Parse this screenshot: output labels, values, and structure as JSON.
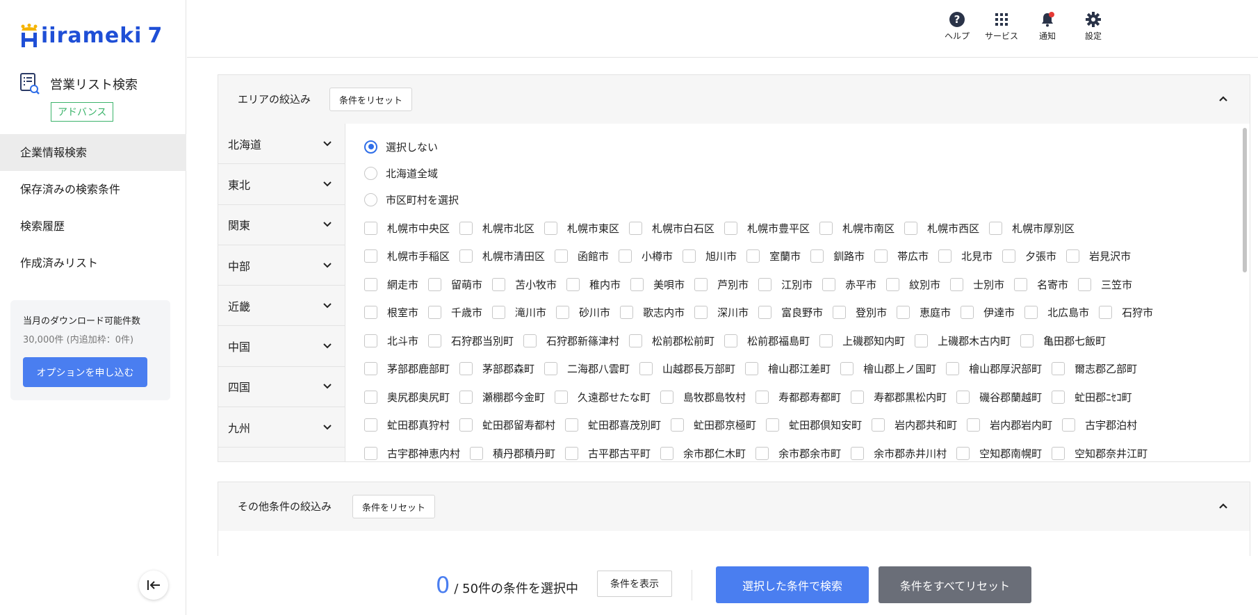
{
  "app": {
    "logo_main": "iirameki",
    "logo_num": "7"
  },
  "product": {
    "title": "営業リスト検索",
    "badge": "アドバンス"
  },
  "nav": [
    {
      "label": "企業情報検索",
      "active": true
    },
    {
      "label": "保存済みの検索条件"
    },
    {
      "label": "検索履歴"
    },
    {
      "label": "作成済みリスト"
    }
  ],
  "download": {
    "title": "当月のダウンロード可能件数",
    "sub": "30,000件 (内追加枠：0件)",
    "button": "オプションを申し込む"
  },
  "topbar": {
    "help": "ヘルプ",
    "service": "サービス",
    "notify": "通知",
    "settings": "設定",
    "accent": "#e53935"
  },
  "area_panel": {
    "title": "エリアの絞込み",
    "reset": "条件をリセット",
    "regions": [
      "北海道",
      "東北",
      "関東",
      "中部",
      "近畿",
      "中国",
      "四国",
      "九州"
    ],
    "radios": [
      {
        "label": "選択しない",
        "checked": true
      },
      {
        "label": "北海道全域",
        "checked": false
      },
      {
        "label": "市区町村を選択",
        "checked": false
      }
    ],
    "rows": [
      [
        "札幌市中央区",
        "札幌市北区",
        "札幌市東区",
        "札幌市白石区",
        "札幌市豊平区",
        "札幌市南区",
        "札幌市西区",
        "札幌市厚別区"
      ],
      [
        "札幌市手稲区",
        "札幌市清田区",
        "函館市",
        "小樽市",
        "旭川市",
        "室蘭市",
        "釧路市",
        "帯広市",
        "北見市",
        "夕張市",
        "岩見沢市"
      ],
      [
        "網走市",
        "留萌市",
        "苫小牧市",
        "稚内市",
        "美唄市",
        "芦別市",
        "江別市",
        "赤平市",
        "紋別市",
        "士別市",
        "名寄市",
        "三笠市"
      ],
      [
        "根室市",
        "千歳市",
        "滝川市",
        "砂川市",
        "歌志内市",
        "深川市",
        "富良野市",
        "登別市",
        "恵庭市",
        "伊達市",
        "北広島市",
        "石狩市"
      ],
      [
        "北斗市",
        "石狩郡当別町",
        "石狩郡新篠津村",
        "松前郡松前町",
        "松前郡福島町",
        "上磯郡知内町",
        "上磯郡木古内町",
        "亀田郡七飯町"
      ],
      [
        "茅部郡鹿部町",
        "茅部郡森町",
        "二海郡八雲町",
        "山越郡長万部町",
        "檜山郡江差町",
        "檜山郡上ノ国町",
        "檜山郡厚沢部町",
        "爾志郡乙部町"
      ],
      [
        "奥尻郡奥尻町",
        "瀬棚郡今金町",
        "久遠郡せたな町",
        "島牧郡島牧村",
        "寿都郡寿都町",
        "寿都郡黒松内町",
        "磯谷郡蘭越町",
        "虻田郡ﾆｾｺ町"
      ],
      [
        "虻田郡真狩村",
        "虻田郡留寿都村",
        "虻田郡喜茂別町",
        "虻田郡京極町",
        "虻田郡倶知安町",
        "岩内郡共和町",
        "岩内郡岩内町",
        "古宇郡泊村"
      ],
      [
        "古宇郡神恵内村",
        "積丹郡積丹町",
        "古平郡古平町",
        "余市郡仁木町",
        "余市郡余市町",
        "余市郡赤井川村",
        "空知郡南幌町",
        "空知郡奈井江町"
      ]
    ]
  },
  "other_panel": {
    "title": "その他条件の絞込み",
    "reset": "条件をリセット"
  },
  "bottom": {
    "count": "0",
    "count_text": "/ 50件の条件を選択中",
    "show": "条件を表示",
    "search": "選択した条件で検索",
    "reset_all": "条件をすべてリセット"
  }
}
